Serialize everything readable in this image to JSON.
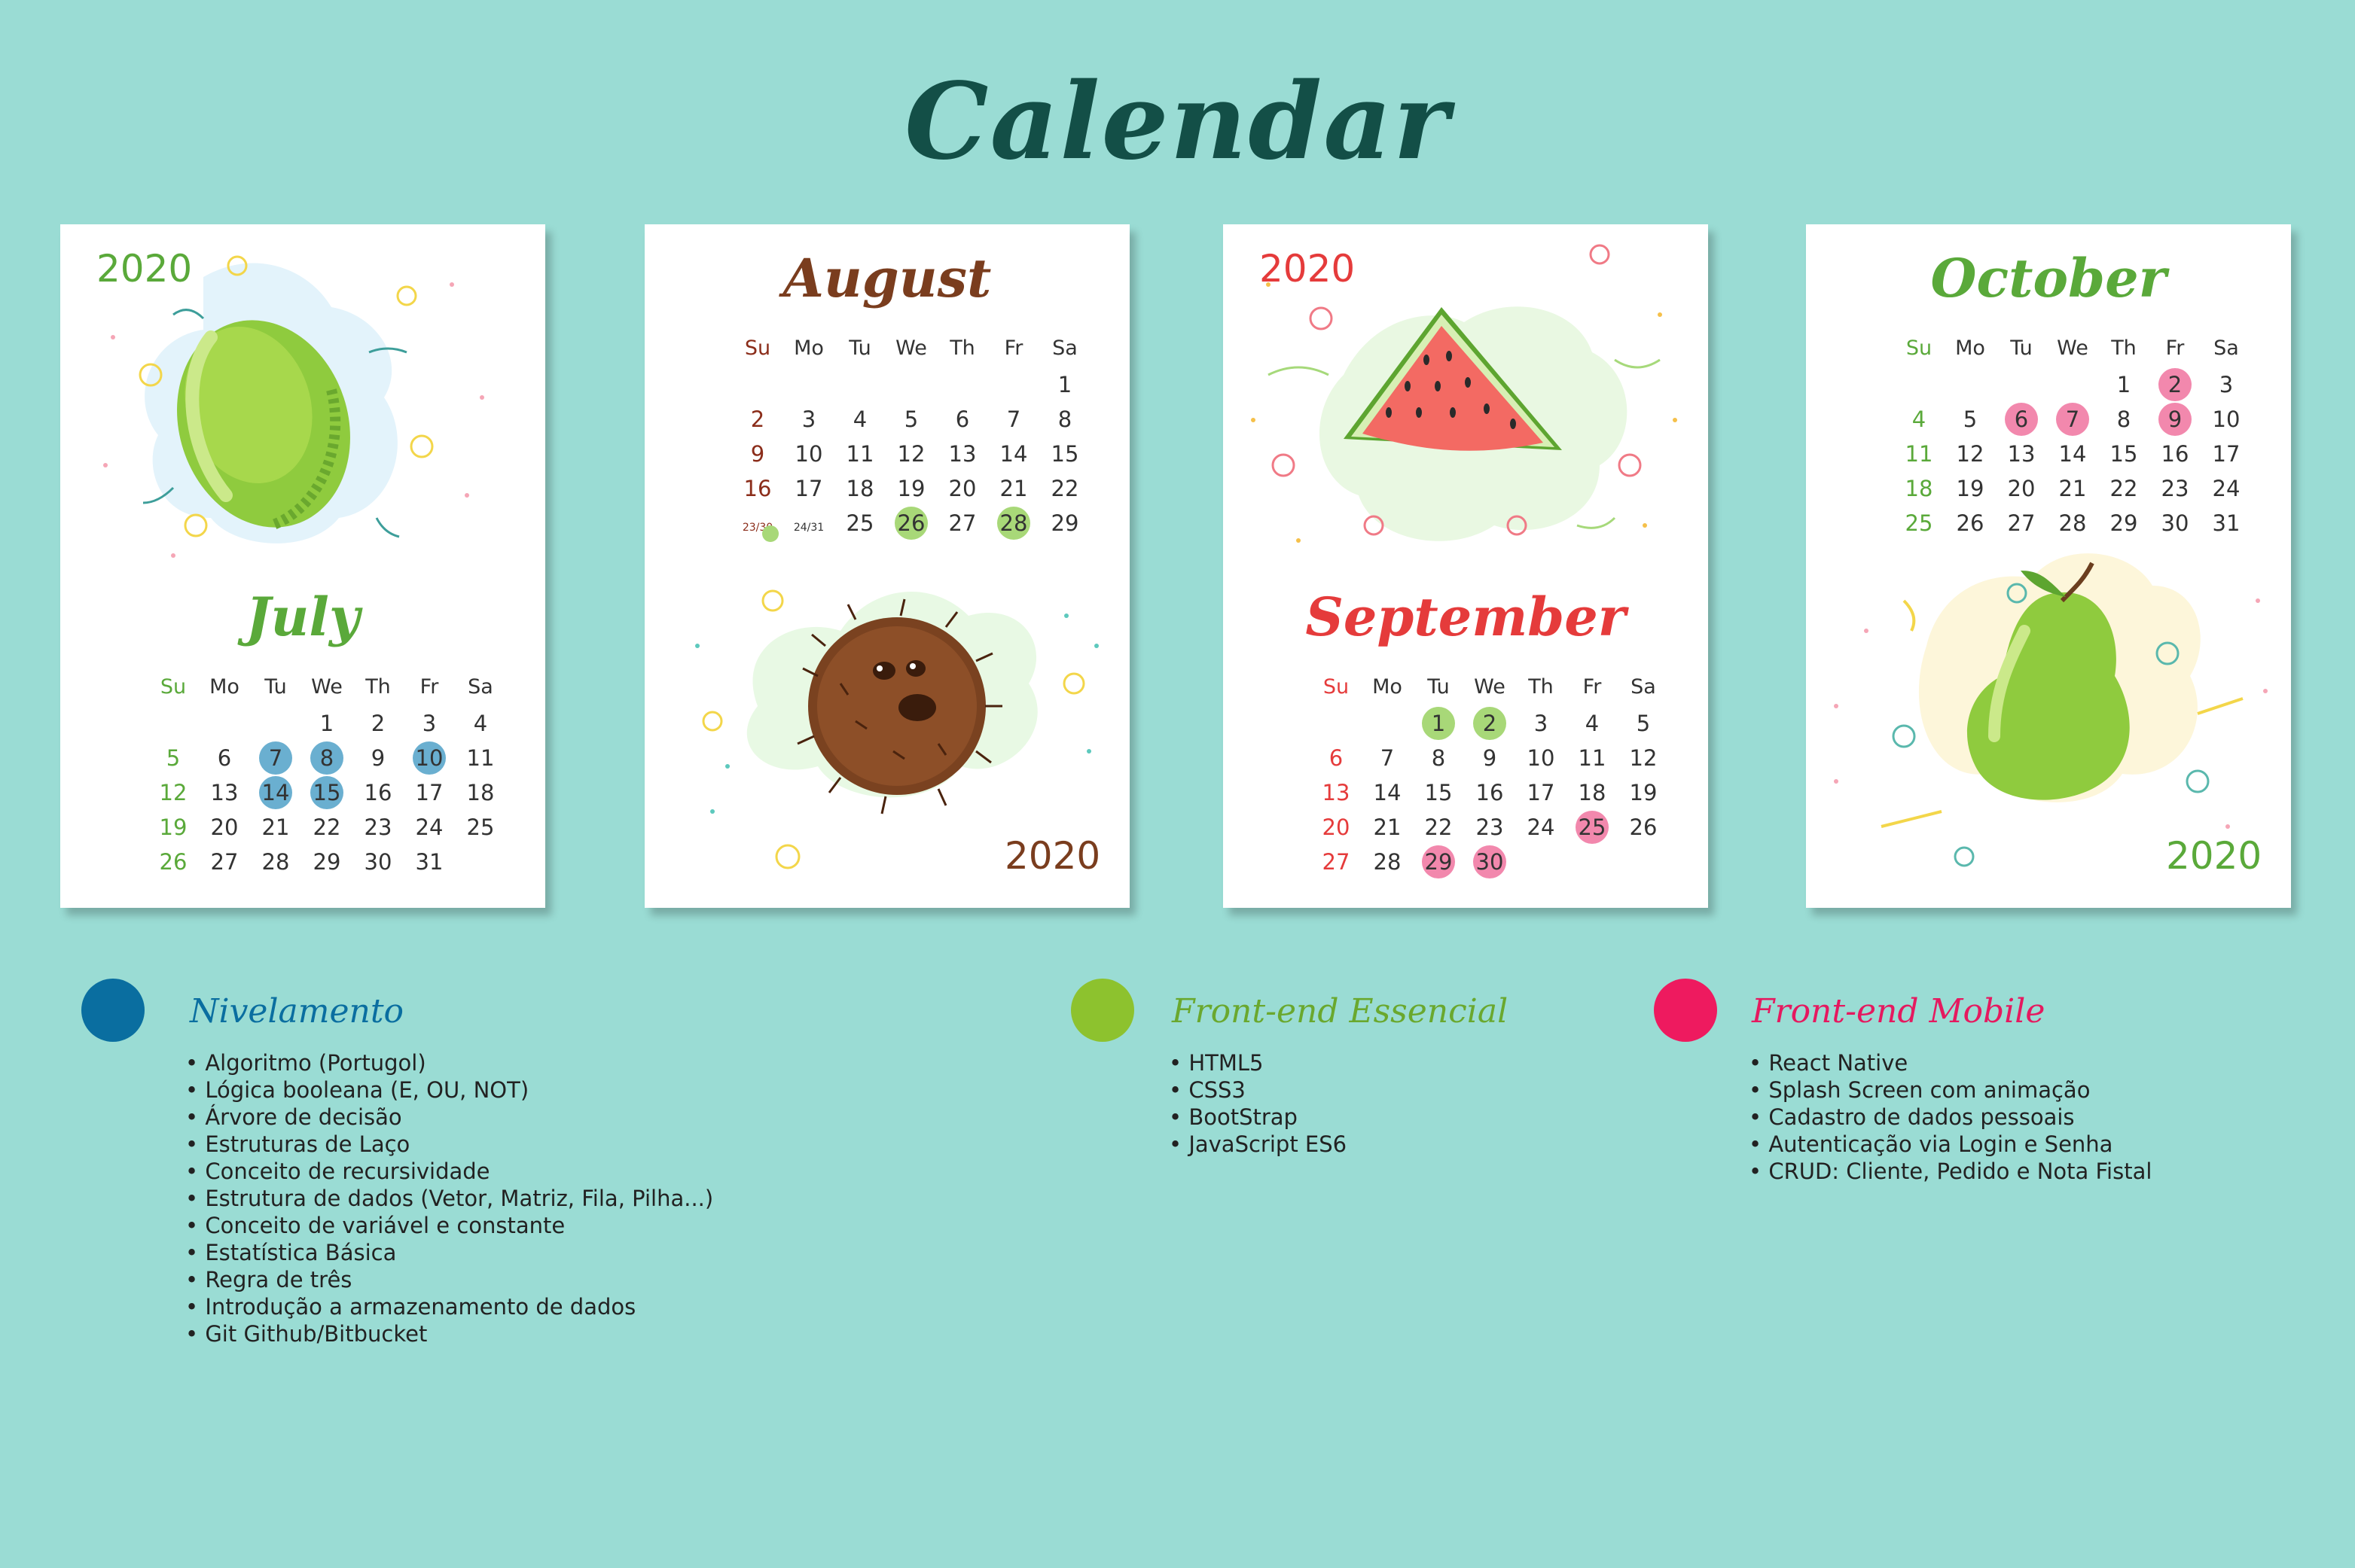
{
  "title": "Calendar",
  "colors": {
    "background": "#9adcd4",
    "nivelamento": "#0a6ea0",
    "front_essencial": "#8dc22e",
    "front_mobile": "#ee1a5f"
  },
  "cards": {
    "july": {
      "year": "2020",
      "month": "July",
      "weekdays": [
        "Su",
        "Mo",
        "Tu",
        "We",
        "Th",
        "Fr",
        "Sa"
      ],
      "illustration": "lime-icon"
    },
    "august": {
      "year": "2020",
      "month": "August",
      "weekdays": [
        "Su",
        "Mo",
        "Tu",
        "We",
        "Th",
        "Fr",
        "Sa"
      ],
      "illustration": "coconut-icon",
      "dual_dates": [
        "23/30",
        "24/31"
      ]
    },
    "september": {
      "year": "2020",
      "month": "September",
      "weekdays": [
        "Su",
        "Mo",
        "Tu",
        "We",
        "Th",
        "Fr",
        "Sa"
      ],
      "illustration": "watermelon-icon"
    },
    "october": {
      "year": "2020",
      "month": "October",
      "weekdays": [
        "Su",
        "Mo",
        "Tu",
        "We",
        "Th",
        "Fr",
        "Sa"
      ],
      "illustration": "pear-icon"
    }
  },
  "legend": {
    "nivelamento": {
      "title": "Nivelamento",
      "items": [
        "• Algoritmo (Portugol)",
        "• Lógica booleana (E, OU, NOT)",
        "• Árvore de decisão",
        "• Estruturas de Laço",
        "• Conceito de recursividade",
        "• Estrutura de dados (Vetor, Matriz, Fila, Pilha...)",
        "• Conceito de variável e constante",
        "• Estatística Básica",
        "• Regra de três",
        "• Introdução a armazenamento de dados",
        "• Git Github/Bitbucket"
      ]
    },
    "front_essencial": {
      "title": "Front-end Essencial",
      "items": [
        "• HTML5",
        "• CSS3",
        "• BootStrap",
        "• JavaScript ES6"
      ]
    },
    "front_mobile": {
      "title": "Front-end Mobile",
      "items": [
        "• React Native",
        "• Splash Screen com animação",
        "• Cadastro de dados pessoais",
        "• Autenticação via Login e Senha",
        "• CRUD: Cliente, Pedido e Nota Fistal"
      ]
    }
  }
}
